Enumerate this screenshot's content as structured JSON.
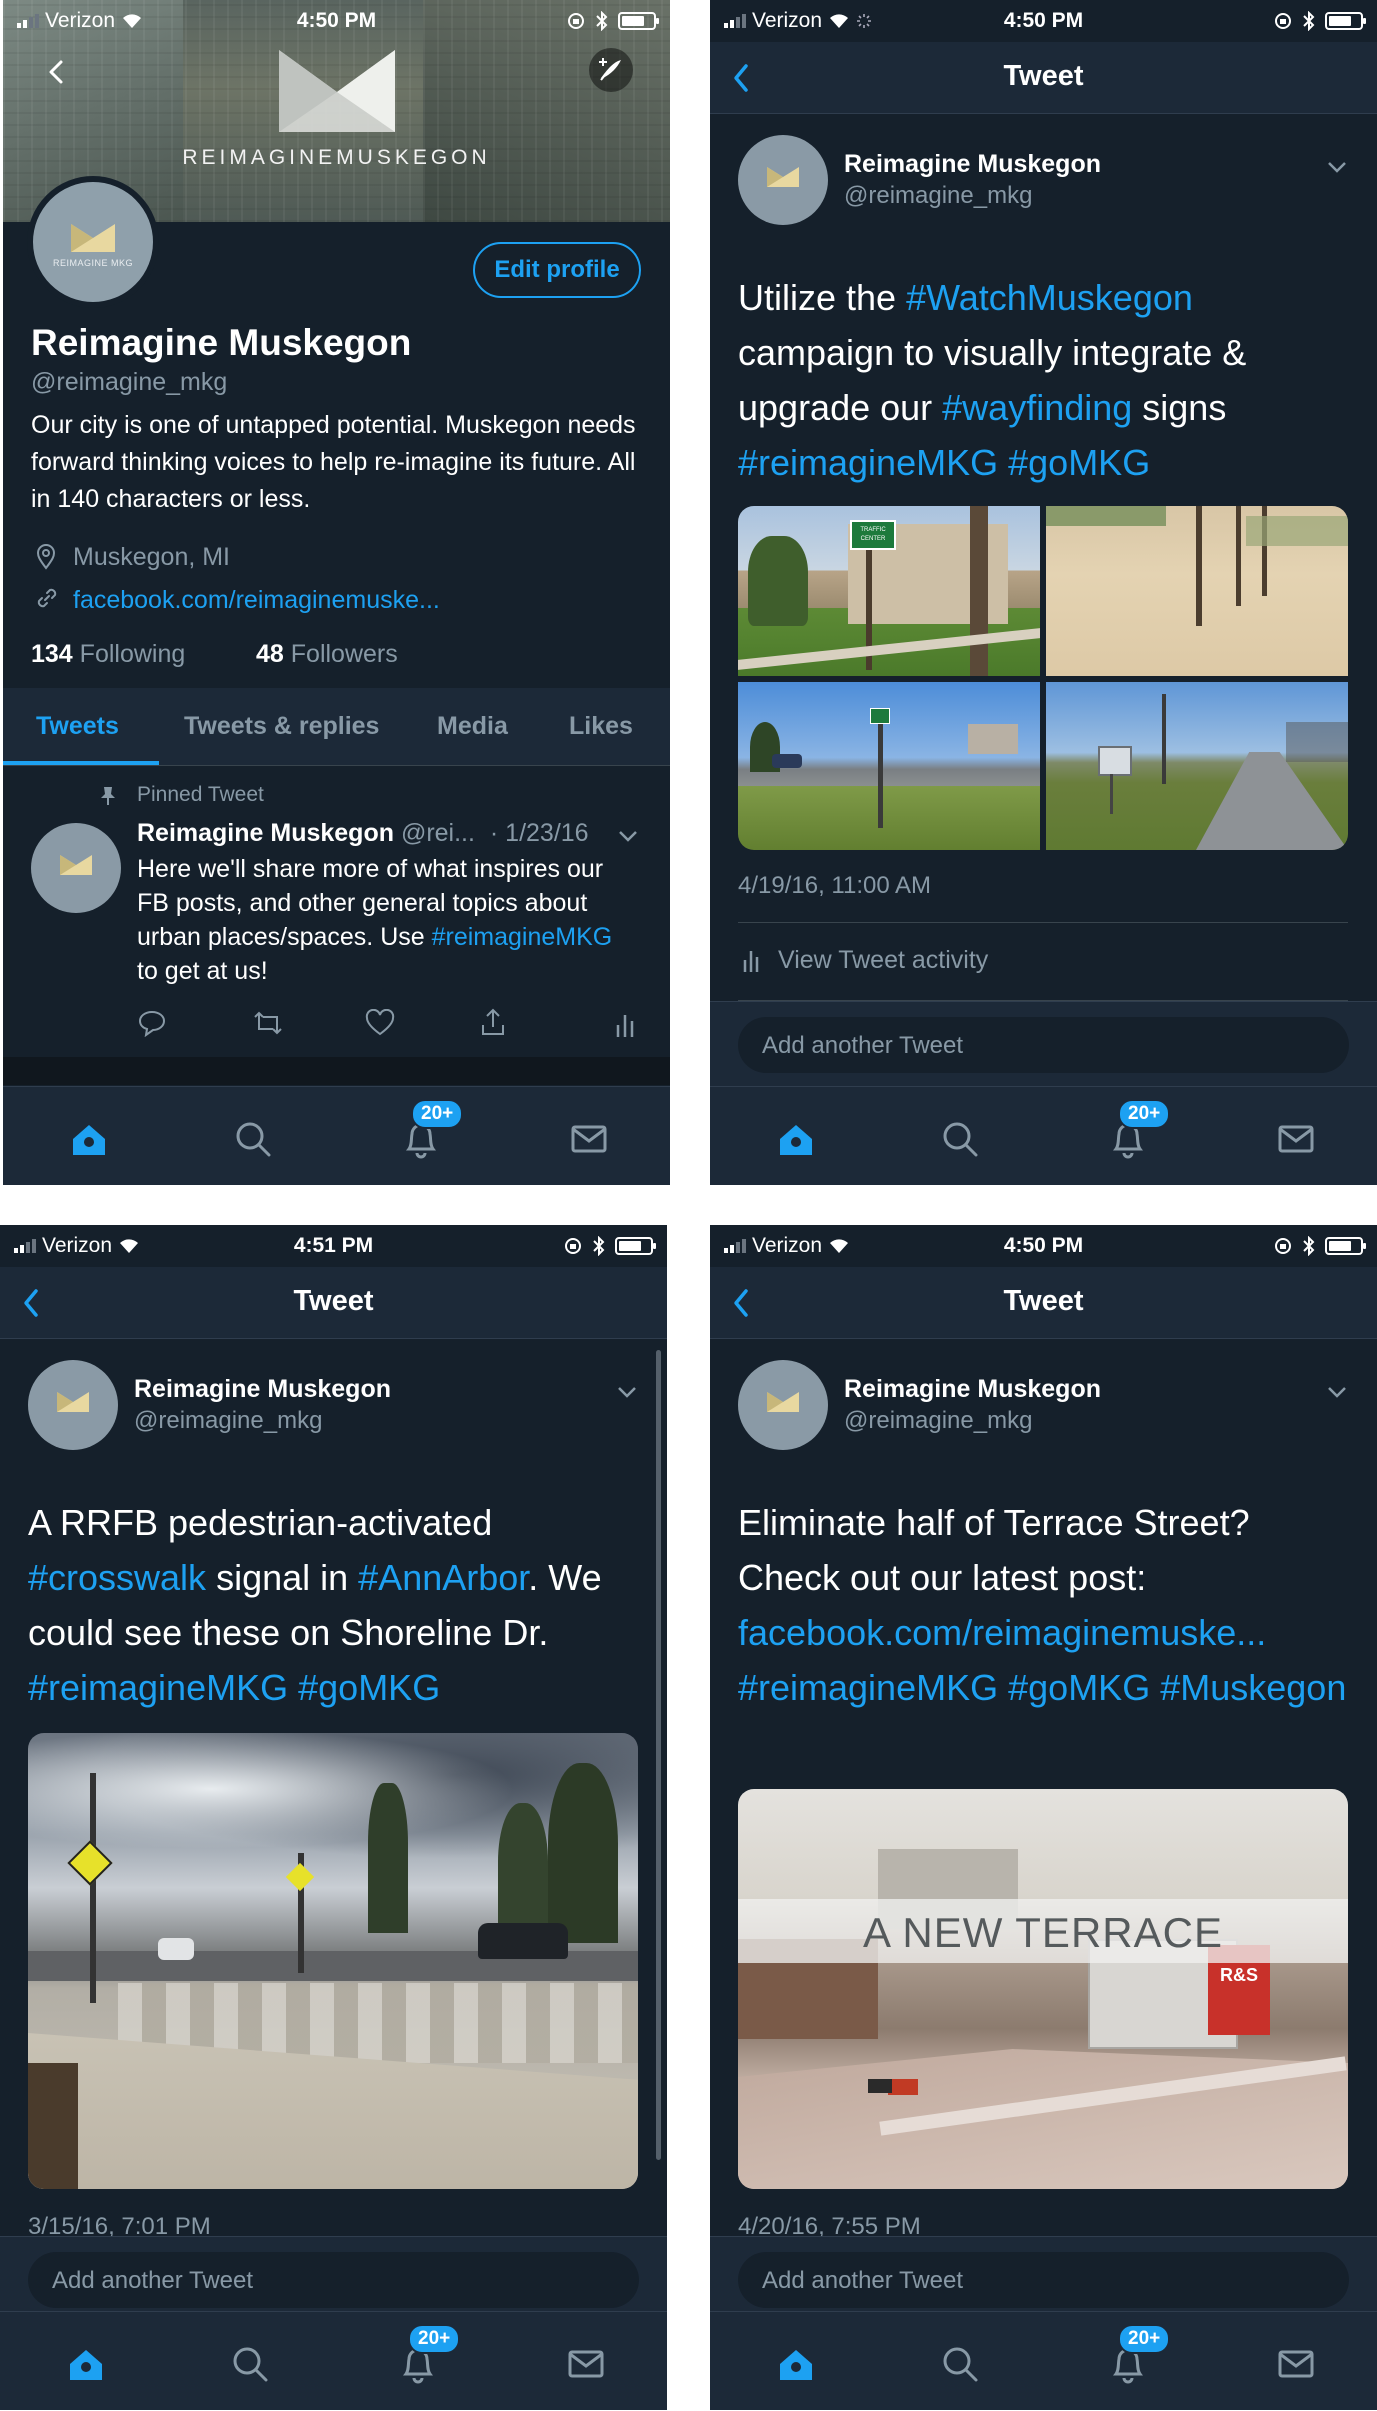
{
  "status": {
    "carrier": "Verizon",
    "time_a": "4:50 PM",
    "time_b": "4:51 PM"
  },
  "profile": {
    "banner_logo": "REIMAGINEMUSKEGON",
    "avatar_text": "REIMAGINE MKG",
    "name": "Reimagine Muskegon",
    "handle": "@reimagine_mkg",
    "edit_label": "Edit profile",
    "bio": "Our city is one of untapped potential. Muskegon needs forward thinking voices to help re-imagine its future. All in 140 characters or less.",
    "location": "Muskegon, MI",
    "website": "facebook.com/reimaginemuske...",
    "following_count": "134",
    "following_label": "Following",
    "followers_count": "48",
    "followers_label": "Followers",
    "tabs": [
      "Tweets",
      "Tweets & replies",
      "Media",
      "Likes"
    ],
    "pinned_label": "Pinned Tweet",
    "pinned": {
      "name": "Reimagine Muskegon",
      "handle": "@rei...",
      "date": "· 1/23/16",
      "text_main": "Here we'll share more of what inspires our FB posts, and other general topics about urban places/spaces. Use ",
      "hashtag": "#reimagineMKG",
      "text_tail": " to get at us!"
    }
  },
  "nav": {
    "title": "Tweet",
    "add_placeholder": "Add another Tweet",
    "badge": "20+"
  },
  "tweet2": {
    "name": "Reimagine Muskegon",
    "handle": "@reimagine_mkg",
    "t1": "Utilize the ",
    "h1": "#WatchMuskegon",
    "t2": " campaign to visually integrate & upgrade our ",
    "h2": "#wayfinding",
    "t3": " signs ",
    "h3": "#reimagineMKG",
    "t4": " ",
    "h4": "#goMKG",
    "sign_text": "TRAFFIC CENTER",
    "timestamp": "4/19/16, 11:00 AM",
    "activity": "View Tweet activity"
  },
  "tweet3": {
    "name": "Reimagine Muskegon",
    "handle": "@reimagine_mkg",
    "t1": "A RRFB pedestrian-activated ",
    "h1": "#crosswalk",
    "t2": " signal in ",
    "h2": "#AnnArbor",
    "t3": ". We could see these on Shoreline Dr. ",
    "h3": "#reimagineMKG",
    "t4": " ",
    "h4": "#goMKG",
    "timestamp": "3/15/16, 7:01 PM"
  },
  "tweet4": {
    "name": "Reimagine Muskegon",
    "handle": "@reimagine_mkg",
    "t1": "Eliminate half of Terrace Street? Check out our latest post: ",
    "l1": "facebook.com/reimaginemuske...",
    "t2": " ",
    "h1": "#reimagineMKG",
    "t3": " ",
    "h2": "#goMKG",
    "t4": " ",
    "h3": "#Muskegon",
    "image_title": "A NEW TERRACE",
    "store_sign": "R&S",
    "timestamp": "4/20/16, 7:55 PM"
  },
  "colors": {
    "background": "#15202b",
    "bar": "#1c2938",
    "accent": "#1da1f2",
    "muted": "#8899a6"
  },
  "icons": [
    "home-icon",
    "search-icon",
    "bell-icon",
    "mail-icon",
    "back-icon",
    "compose-icon",
    "location-icon",
    "link-icon",
    "pin-icon",
    "reply-icon",
    "retweet-icon",
    "like-icon",
    "share-icon",
    "activity-icon",
    "caret-icon"
  ]
}
